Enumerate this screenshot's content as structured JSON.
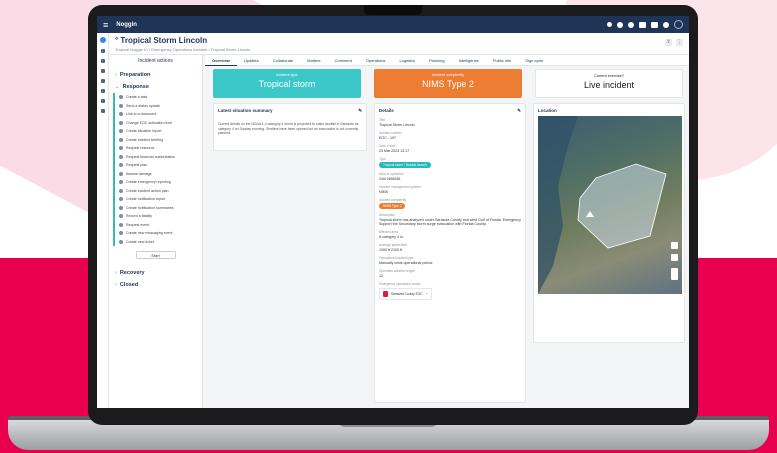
{
  "app": {
    "title": "Noggin"
  },
  "page": {
    "title": "Tropical Storm Lincoln",
    "breadcrumb": "Tropical Noggin IC / Emergency Operations Incident / Tropical Storm Lincoln"
  },
  "sidebar": {
    "header": "Incident actions",
    "phases": {
      "preparation": "Preparation",
      "response": "Response",
      "recovery": "Recovery",
      "closed": "Closed"
    },
    "items": [
      "Create a task",
      "Send a status update",
      "Link to a document",
      "Change EOC activation level",
      "Create situation report",
      "Create incident briefing",
      "Request resource",
      "Request financial authorization",
      "Request plan",
      "Assess damage",
      "Create emergency reporting",
      "Create incident action plan",
      "Create notification report",
      "Create notification summaries",
      "Record a fatality",
      "Request event",
      "Create new messaging event",
      "Create new ticket"
    ],
    "start_button": "Start"
  },
  "tabs": [
    "Overview",
    "Updates",
    "Collaborate",
    "Matters",
    "Comment",
    "Operations",
    "Logistics",
    "Planning",
    "Intelligence",
    "Public info",
    "Sign cycle"
  ],
  "cards": {
    "incident_type": {
      "label": "Incident type",
      "value": "Tropical storm",
      "color": "#3cc8c8"
    },
    "incident_complexity": {
      "label": "Incident complexity",
      "value": "NIMS Type 2",
      "color": "#ee7d34"
    },
    "current_exercise": {
      "label": "Current exercise?",
      "value": "Live incident"
    }
  },
  "situation": {
    "title": "Latest situation summary",
    "text": "Current details on the NOAA 1-4 category 4 storm is projected to make landfall in Sarasota as category 4 on Sunday morning. Shelters have been opened but an evacuation is not currently planned."
  },
  "details": {
    "title": "Details",
    "fields": [
      {
        "k": "Title",
        "v": "Tropical Storm Lincoln"
      },
      {
        "k": "Incident number",
        "v": "EOC - 197"
      },
      {
        "k": "Date & time",
        "v": "25 Mar 2023 13:17"
      },
      {
        "k": "Type",
        "badge": "Tropical storm / Natural hazard",
        "badge_color": "#26b9b9"
      },
      {
        "k": "Area of operation",
        "v": "Grid 0658381"
      },
      {
        "k": "Incident management system",
        "v": "NIMS"
      },
      {
        "k": "Incident complexity",
        "badge": "NIMS Type 2",
        "badge_color": "#ee7d34"
      },
      {
        "k": "Description",
        "v": "Tropical storm has analyzed under Sarasota County and wind Gulf of Florida. Emergency Support the Secondary storm surge evacuation with Florida County."
      },
      {
        "k": "Affected area",
        "v": "A category 4 in"
      },
      {
        "k": "Average speed limit",
        "v": "1000 ft 2100 ft"
      },
      {
        "k": "Operations incident type",
        "v": "Manually crisis operational period"
      },
      {
        "k": "Operation duration length",
        "v": "12"
      },
      {
        "k": "Emergency operations center",
        "file": "Sarasota County EOC"
      }
    ]
  },
  "location": {
    "title": "Location"
  },
  "colors": {
    "topbar": "#1f3557",
    "accent": "#3ab6c3",
    "brand_red": "#e8004e"
  }
}
